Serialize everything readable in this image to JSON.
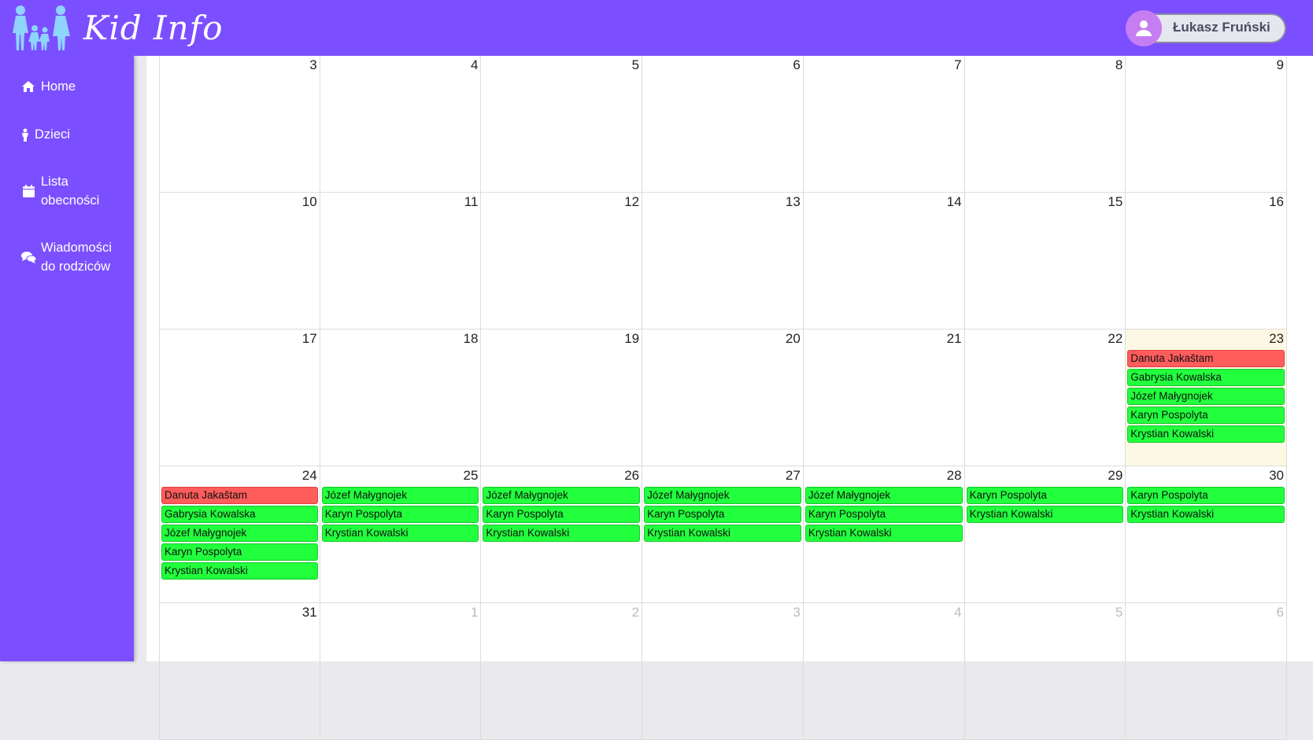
{
  "app": {
    "logo_text": "Kid Info"
  },
  "header": {
    "user_name": "Łukasz Fruński"
  },
  "sidebar": {
    "items": [
      {
        "label": "Home",
        "icon": "home-icon"
      },
      {
        "label": "Dzieci",
        "icon": "child-icon"
      },
      {
        "label": "Lista obecności",
        "icon": "calendar-icon"
      },
      {
        "label": "Wiadomości do rodziców",
        "icon": "comments-icon"
      }
    ]
  },
  "colors": {
    "brand": "#7b4fff",
    "present": "#22ff3d",
    "absent": "#ff5c5c",
    "today": "#fcf8e3"
  },
  "calendar": {
    "weeks": [
      [
        {
          "day": "3",
          "events": []
        },
        {
          "day": "4",
          "events": []
        },
        {
          "day": "5",
          "events": []
        },
        {
          "day": "6",
          "events": []
        },
        {
          "day": "7",
          "events": []
        },
        {
          "day": "8",
          "events": []
        },
        {
          "day": "9",
          "events": []
        }
      ],
      [
        {
          "day": "10",
          "events": []
        },
        {
          "day": "11",
          "events": []
        },
        {
          "day": "12",
          "events": []
        },
        {
          "day": "13",
          "events": []
        },
        {
          "day": "14",
          "events": []
        },
        {
          "day": "15",
          "events": []
        },
        {
          "day": "16",
          "events": []
        }
      ],
      [
        {
          "day": "17",
          "events": []
        },
        {
          "day": "18",
          "events": []
        },
        {
          "day": "19",
          "events": []
        },
        {
          "day": "20",
          "events": []
        },
        {
          "day": "21",
          "events": []
        },
        {
          "day": "22",
          "events": []
        },
        {
          "day": "23",
          "today": true,
          "events": [
            {
              "name": "Danuta Jakaštam",
              "status": "absent"
            },
            {
              "name": "Gabrysia Kowalska",
              "status": "present"
            },
            {
              "name": "Józef Małygnojek",
              "status": "present"
            },
            {
              "name": "Karyn Pospolyta",
              "status": "present"
            },
            {
              "name": "Krystian Kowalski",
              "status": "present"
            }
          ]
        }
      ],
      [
        {
          "day": "24",
          "events": [
            {
              "name": "Danuta Jakaštam",
              "status": "absent"
            },
            {
              "name": "Gabrysia Kowalska",
              "status": "present"
            },
            {
              "name": "Józef Małygnojek",
              "status": "present"
            },
            {
              "name": "Karyn Pospolyta",
              "status": "present"
            },
            {
              "name": "Krystian Kowalski",
              "status": "present"
            }
          ]
        },
        {
          "day": "25",
          "events": [
            {
              "name": "Józef Małygnojek",
              "status": "present"
            },
            {
              "name": "Karyn Pospolyta",
              "status": "present"
            },
            {
              "name": "Krystian Kowalski",
              "status": "present"
            }
          ]
        },
        {
          "day": "26",
          "events": [
            {
              "name": "Józef Małygnojek",
              "status": "present"
            },
            {
              "name": "Karyn Pospolyta",
              "status": "present"
            },
            {
              "name": "Krystian Kowalski",
              "status": "present"
            }
          ]
        },
        {
          "day": "27",
          "events": [
            {
              "name": "Józef Małygnojek",
              "status": "present"
            },
            {
              "name": "Karyn Pospolyta",
              "status": "present"
            },
            {
              "name": "Krystian Kowalski",
              "status": "present"
            }
          ]
        },
        {
          "day": "28",
          "events": [
            {
              "name": "Józef Małygnojek",
              "status": "present"
            },
            {
              "name": "Karyn Pospolyta",
              "status": "present"
            },
            {
              "name": "Krystian Kowalski",
              "status": "present"
            }
          ]
        },
        {
          "day": "29",
          "events": [
            {
              "name": "Karyn Pospolyta",
              "status": "present"
            },
            {
              "name": "Krystian Kowalski",
              "status": "present"
            }
          ]
        },
        {
          "day": "30",
          "events": [
            {
              "name": "Karyn Pospolyta",
              "status": "present"
            },
            {
              "name": "Krystian Kowalski",
              "status": "present"
            }
          ]
        }
      ],
      [
        {
          "day": "31",
          "events": []
        },
        {
          "day": "1",
          "other": true,
          "events": []
        },
        {
          "day": "2",
          "other": true,
          "events": []
        },
        {
          "day": "3",
          "other": true,
          "events": []
        },
        {
          "day": "4",
          "other": true,
          "events": []
        },
        {
          "day": "5",
          "other": true,
          "events": []
        },
        {
          "day": "6",
          "other": true,
          "events": []
        }
      ]
    ]
  }
}
